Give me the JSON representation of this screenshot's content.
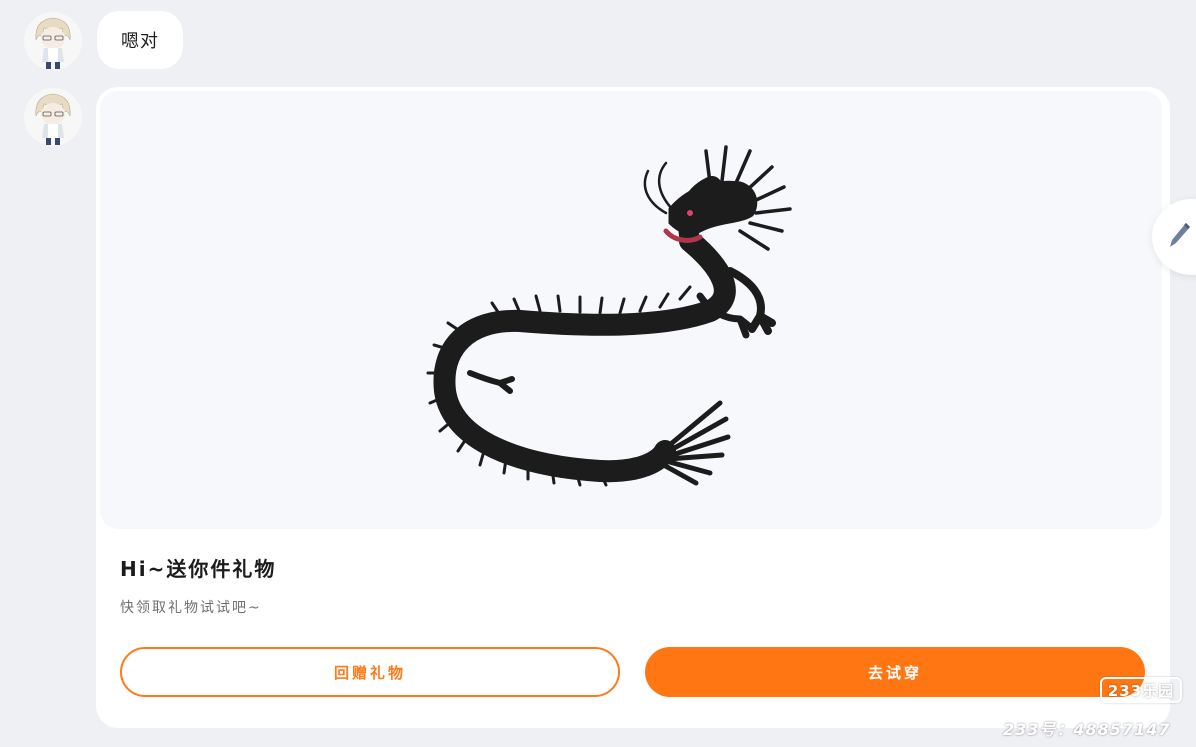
{
  "chat": {
    "messages": [
      {
        "type": "text",
        "text": "嗯对"
      },
      {
        "type": "gift",
        "image_icon": "dragon-image",
        "title": "Hi~送你件礼物",
        "subtitle": "快领取礼物试试吧~",
        "reply_button": "回赠礼物",
        "try_button": "去试穿"
      }
    ]
  },
  "floating": {
    "edit_icon": "pencil-icon"
  },
  "watermark": {
    "logo": "233乐园",
    "id_text": "233号：48857147"
  },
  "colors": {
    "accent": "#ff7613",
    "page_background": "#eef0f3",
    "card_background": "#ffffff"
  }
}
